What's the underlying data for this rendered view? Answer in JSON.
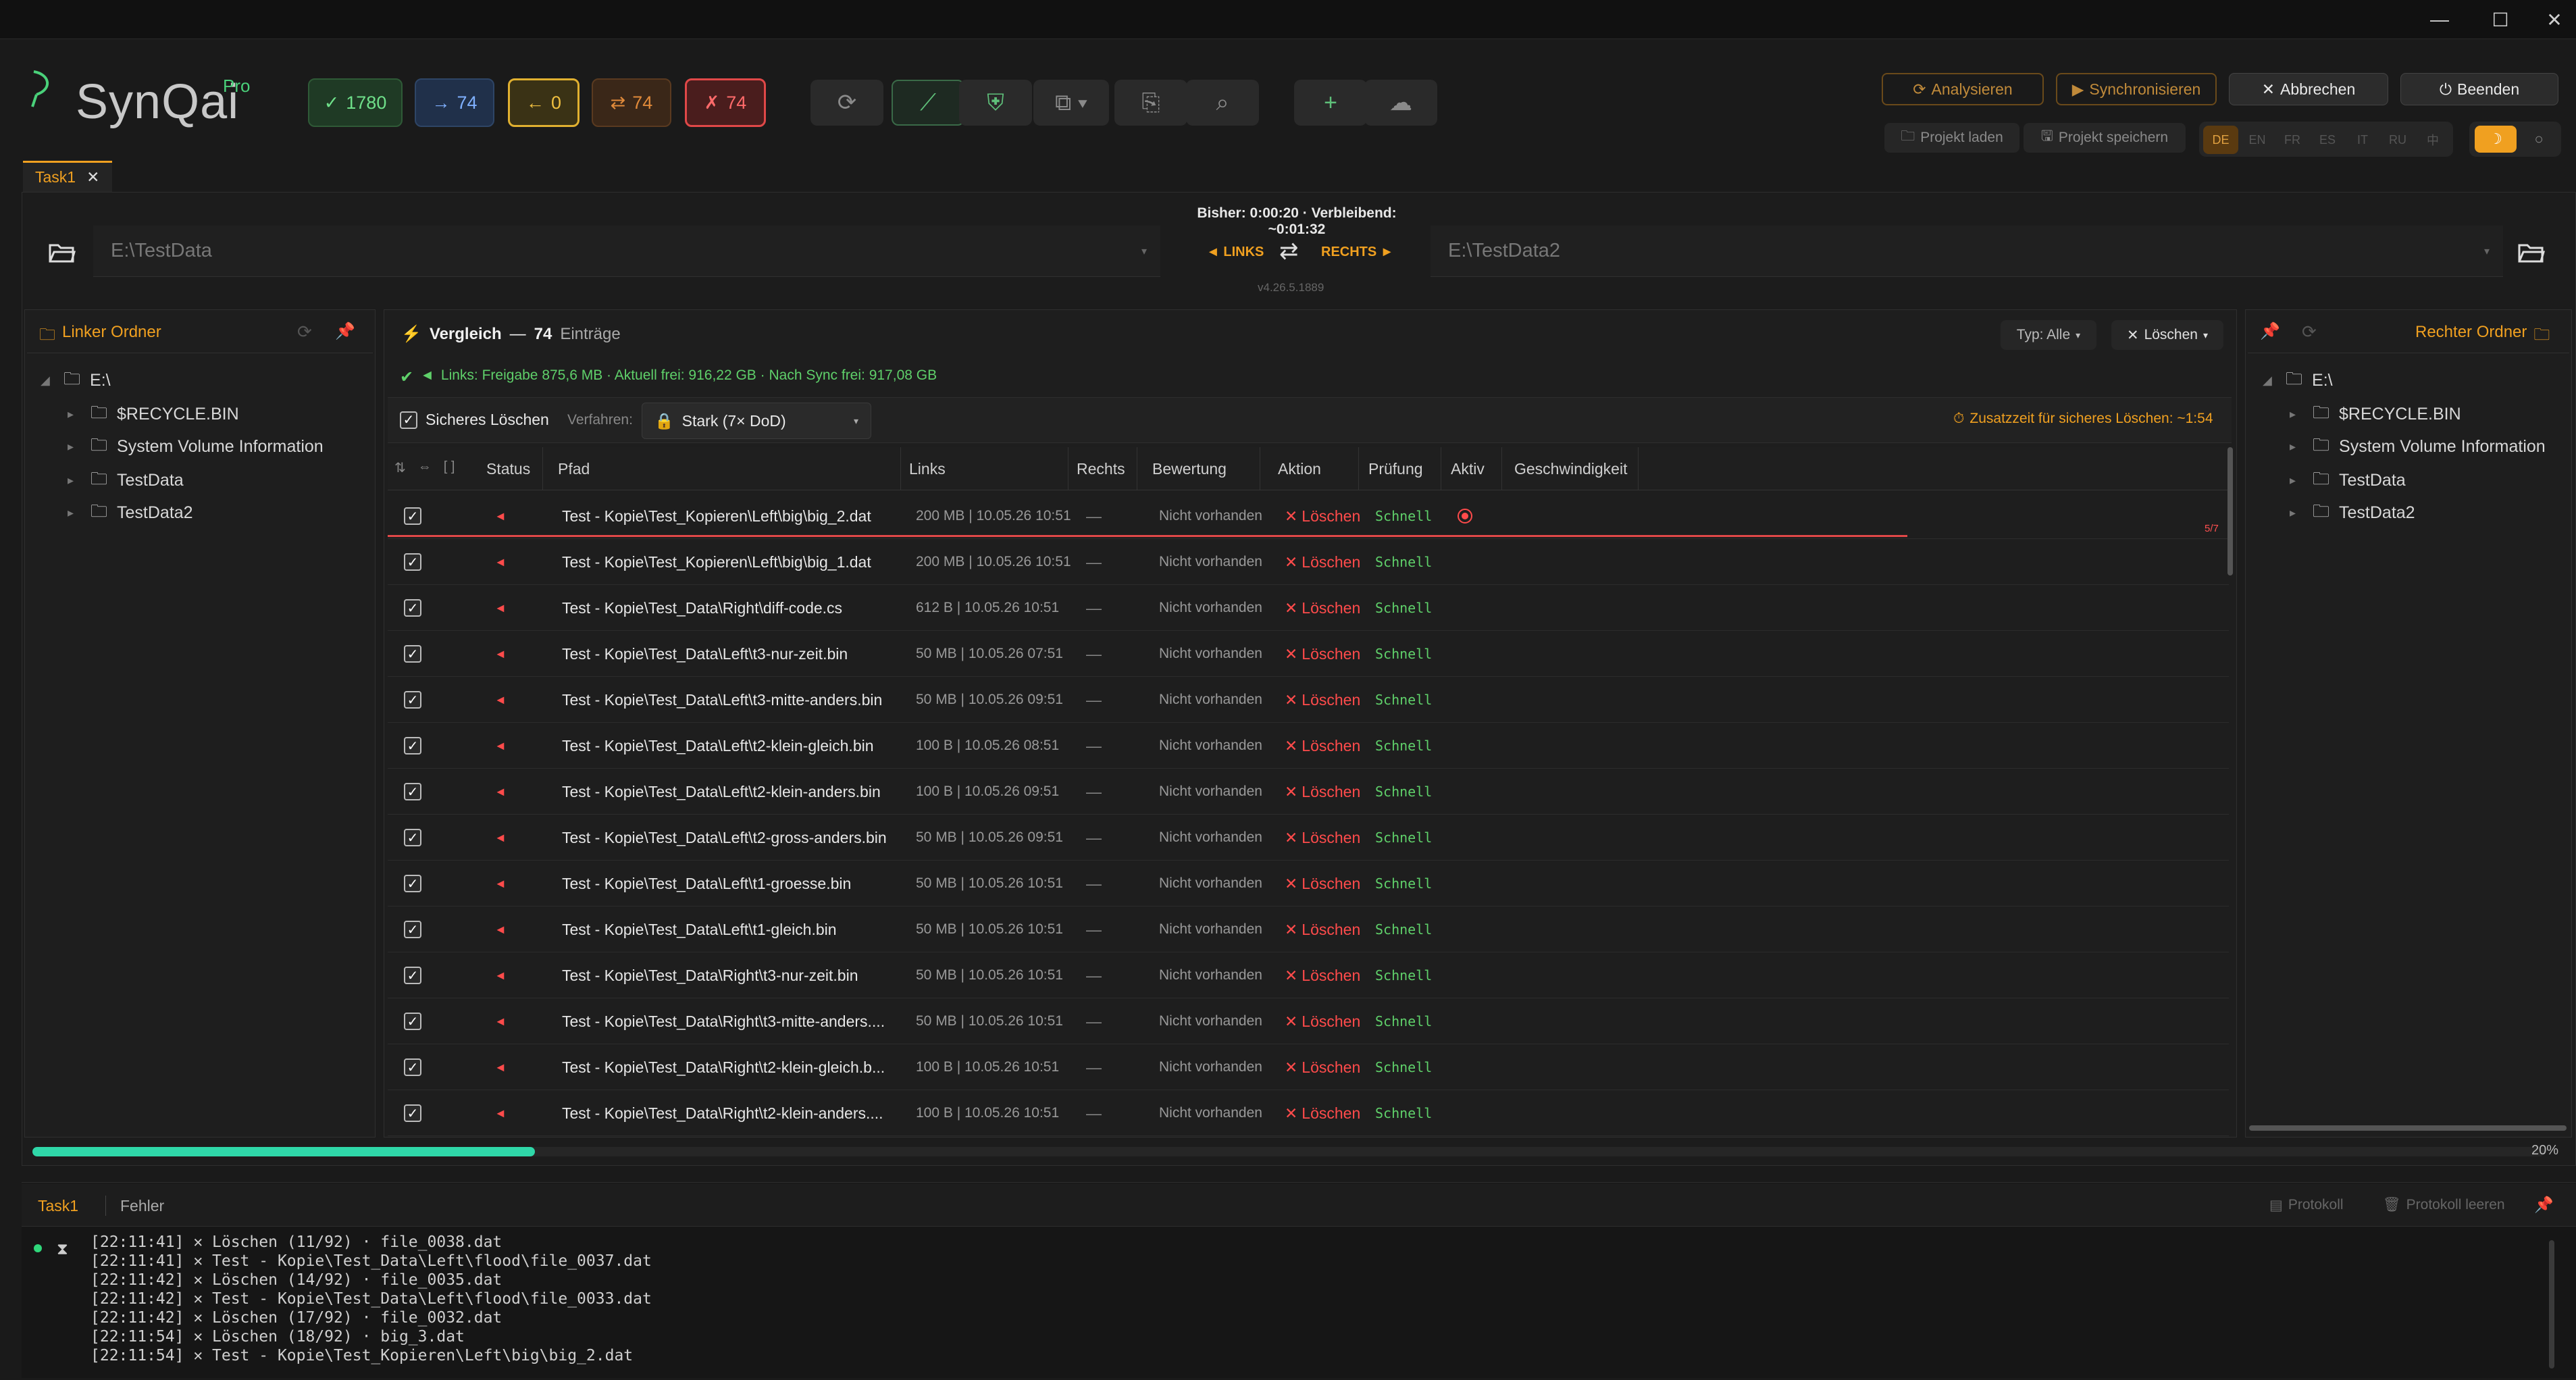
{
  "app": {
    "brand": "SynQai",
    "edition": "Pro",
    "version": "v4.26.5.1889"
  },
  "window": {
    "minimize": "—",
    "maximize": "☐",
    "close": "✕"
  },
  "stats": [
    {
      "icon": "✓",
      "value": "1780",
      "color": "#4ad17a"
    },
    {
      "icon": "→",
      "value": "74",
      "color": "#6aa8ff"
    },
    {
      "icon": "←",
      "value": "0",
      "color": "#f0c040"
    },
    {
      "icon": "⇄",
      "value": "74",
      "color": "#e08a3a"
    },
    {
      "icon": "✗",
      "value": "74",
      "color": "#ff6060"
    }
  ],
  "actions": {
    "analyze": "Analysieren",
    "sync": "Synchronisieren",
    "cancel": "Abbrechen",
    "quit": "Beenden",
    "load_project": "Projekt laden",
    "save_project": "Projekt speichern"
  },
  "languages": [
    "DE",
    "EN",
    "FR",
    "ES",
    "IT",
    "RU",
    "中"
  ],
  "tabs": {
    "task": "Task1"
  },
  "paths": {
    "left": "E:\\TestData",
    "right": "E:\\TestData2",
    "left_label": "◄ LINKS",
    "right_label": "RECHTS ►",
    "timer": "Bisher: 0:00:20 · Verbleibend: ~0:01:32"
  },
  "left_panel": {
    "title": "Linker Ordner",
    "root": "E:\\",
    "items": [
      "$RECYCLE.BIN",
      "System Volume Information",
      "TestData",
      "TestData2"
    ]
  },
  "right_panel": {
    "title": "Rechter Ordner",
    "root": "E:\\",
    "items": [
      "$RECYCLE.BIN",
      "System Volume Information",
      "TestData",
      "TestData2"
    ]
  },
  "compare": {
    "title": "Vergleich",
    "sep": "—",
    "count": "74",
    "entries_label": "Einträge",
    "type_filter": "Typ: Alle",
    "delete_filter": "Löschen",
    "info": "Links: Freigabe 875,6 MB · Aktuell frei: 916,22 GB · Nach Sync frei: 917,08 GB",
    "secure_delete": "Sicheres Löschen",
    "method_label": "Verfahren:",
    "method_value": "Stark (7× DoD)",
    "extra_time": "Zusatzzeit für sicheres Löschen: ~1:54",
    "progress_badge": "5/7"
  },
  "columns": {
    "status": "Status",
    "path": "Pfad",
    "links": "Links",
    "rechts": "Rechts",
    "bewertung": "Bewertung",
    "aktion": "Aktion",
    "pruefung": "Prüfung",
    "aktiv": "Aktiv",
    "speed": "Geschwindigkeit"
  },
  "rows": [
    {
      "path": "Test - Kopie\\Test_Kopieren\\Left\\big\\big_2.dat",
      "links": "200 MB | 10.05.26 10:51",
      "rechts": "—",
      "bewertung": "Nicht vorhanden",
      "aktion": "Löschen",
      "pruefung": "Schnell"
    },
    {
      "path": "Test - Kopie\\Test_Kopieren\\Left\\big\\big_1.dat",
      "links": "200 MB | 10.05.26 10:51",
      "rechts": "—",
      "bewertung": "Nicht vorhanden",
      "aktion": "Löschen",
      "pruefung": "Schnell"
    },
    {
      "path": "Test - Kopie\\Test_Data\\Right\\diff-code.cs",
      "links": "612 B | 10.05.26 10:51",
      "rechts": "—",
      "bewertung": "Nicht vorhanden",
      "aktion": "Löschen",
      "pruefung": "Schnell"
    },
    {
      "path": "Test - Kopie\\Test_Data\\Left\\t3-nur-zeit.bin",
      "links": "50 MB | 10.05.26 07:51",
      "rechts": "—",
      "bewertung": "Nicht vorhanden",
      "aktion": "Löschen",
      "pruefung": "Schnell"
    },
    {
      "path": "Test - Kopie\\Test_Data\\Left\\t3-mitte-anders.bin",
      "links": "50 MB | 10.05.26 09:51",
      "rechts": "—",
      "bewertung": "Nicht vorhanden",
      "aktion": "Löschen",
      "pruefung": "Schnell"
    },
    {
      "path": "Test - Kopie\\Test_Data\\Left\\t2-klein-gleich.bin",
      "links": "100 B | 10.05.26 08:51",
      "rechts": "—",
      "bewertung": "Nicht vorhanden",
      "aktion": "Löschen",
      "pruefung": "Schnell"
    },
    {
      "path": "Test - Kopie\\Test_Data\\Left\\t2-klein-anders.bin",
      "links": "100 B | 10.05.26 09:51",
      "rechts": "—",
      "bewertung": "Nicht vorhanden",
      "aktion": "Löschen",
      "pruefung": "Schnell"
    },
    {
      "path": "Test - Kopie\\Test_Data\\Left\\t2-gross-anders.bin",
      "links": "50 MB | 10.05.26 09:51",
      "rechts": "—",
      "bewertung": "Nicht vorhanden",
      "aktion": "Löschen",
      "pruefung": "Schnell"
    },
    {
      "path": "Test - Kopie\\Test_Data\\Left\\t1-groesse.bin",
      "links": "50 MB | 10.05.26 10:51",
      "rechts": "—",
      "bewertung": "Nicht vorhanden",
      "aktion": "Löschen",
      "pruefung": "Schnell"
    },
    {
      "path": "Test - Kopie\\Test_Data\\Left\\t1-gleich.bin",
      "links": "50 MB | 10.05.26 10:51",
      "rechts": "—",
      "bewertung": "Nicht vorhanden",
      "aktion": "Löschen",
      "pruefung": "Schnell"
    },
    {
      "path": "Test - Kopie\\Test_Data\\Right\\t3-nur-zeit.bin",
      "links": "50 MB | 10.05.26 10:51",
      "rechts": "—",
      "bewertung": "Nicht vorhanden",
      "aktion": "Löschen",
      "pruefung": "Schnell"
    },
    {
      "path": "Test - Kopie\\Test_Data\\Right\\t3-mitte-anders....",
      "links": "50 MB | 10.05.26 10:51",
      "rechts": "—",
      "bewertung": "Nicht vorhanden",
      "aktion": "Löschen",
      "pruefung": "Schnell"
    },
    {
      "path": "Test - Kopie\\Test_Data\\Right\\t2-klein-gleich.b...",
      "links": "100 B | 10.05.26 10:51",
      "rechts": "—",
      "bewertung": "Nicht vorhanden",
      "aktion": "Löschen",
      "pruefung": "Schnell"
    },
    {
      "path": "Test - Kopie\\Test_Data\\Right\\t2-klein-anders....",
      "links": "100 B | 10.05.26 10:51",
      "rechts": "—",
      "bewertung": "Nicht vorhanden",
      "aktion": "Löschen",
      "pruefung": "Schnell"
    }
  ],
  "progress": {
    "fraction": 0.2,
    "label": "20%"
  },
  "bottom": {
    "tab_task": "Task1",
    "tab_errors": "Fehler",
    "protocol": "Protokoll",
    "clear_protocol": "Protokoll leeren",
    "log": [
      "[22:11:41] ✕ Löschen (11/92) · file_0038.dat",
      "[22:11:41] ✕ Test - Kopie\\Test_Data\\Left\\flood\\file_0037.dat",
      "[22:11:42] ✕ Löschen (14/92) · file_0035.dat",
      "[22:11:42] ✕ Test - Kopie\\Test_Data\\Left\\flood\\file_0033.dat",
      "[22:11:42] ✕ Löschen (17/92) · file_0032.dat",
      "[22:11:54] ✕ Löschen (18/92) · big_3.dat",
      "[22:11:54] ✕ Test - Kopie\\Test_Kopieren\\Left\\big\\big_2.dat"
    ]
  }
}
